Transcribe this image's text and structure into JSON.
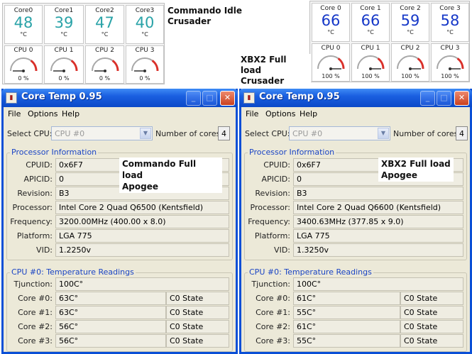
{
  "gadget_left": {
    "cores": [
      {
        "label": "Core0",
        "value": "48",
        "unit": "°C"
      },
      {
        "label": "Core1",
        "value": "39",
        "unit": "°C"
      },
      {
        "label": "Core2",
        "value": "47",
        "unit": "°C"
      },
      {
        "label": "Core3",
        "value": "40",
        "unit": "°C"
      }
    ],
    "meters": [
      {
        "label": "CPU 0",
        "percent_text": "0 %",
        "load": 0
      },
      {
        "label": "CPU 1",
        "percent_text": "0 %",
        "load": 0
      },
      {
        "label": "CPU 2",
        "percent_text": "0 %",
        "load": 0
      },
      {
        "label": "CPU 3",
        "percent_text": "0 %",
        "load": 0
      }
    ],
    "value_color": "#2aa3a8",
    "caption_line1": "Commando Idle",
    "caption_line2": "Crusader"
  },
  "gadget_right": {
    "cores": [
      {
        "label": "Core 0",
        "value": "66",
        "unit": "°C"
      },
      {
        "label": "Core 1",
        "value": "66",
        "unit": "°C"
      },
      {
        "label": "Core 2",
        "value": "59",
        "unit": "°C"
      },
      {
        "label": "Core 3",
        "value": "58",
        "unit": "°C"
      }
    ],
    "meters": [
      {
        "label": "CPU 0",
        "percent_text": "100 %",
        "load": 100
      },
      {
        "label": "CPU 1",
        "percent_text": "100 %",
        "load": 100
      },
      {
        "label": "CPU 2",
        "percent_text": "100 %",
        "load": 100
      },
      {
        "label": "CPU 3",
        "percent_text": "100 %",
        "load": 100
      }
    ],
    "value_color": "#1638c8",
    "caption_line1": "XBX2 Full load",
    "caption_line2": "Crusader"
  },
  "windows": [
    {
      "title": "Core Temp 0.95",
      "menu": [
        "File",
        "Options",
        "Help"
      ],
      "select_cpu_label": "Select CPU:",
      "select_cpu_value": "CPU #0",
      "num_cores_label": "Number of cores",
      "num_cores_value": "4",
      "processor_group_title": "Processor Information",
      "info": [
        {
          "label": "CPUID:",
          "value": "0x6F7"
        },
        {
          "label": "APICID:",
          "value": "0"
        },
        {
          "label": "Revision:",
          "value": "B3"
        },
        {
          "label": "Processor:",
          "value": "Intel Core 2 Quad Q6500 (Kentsfield)"
        },
        {
          "label": "Frequency:",
          "value": "3200.00MHz (400.00 x 8.0)"
        },
        {
          "label": "Platform:",
          "value": "LGA 775"
        },
        {
          "label": "VID:",
          "value": "1.2250v"
        }
      ],
      "overlay_line1": "Commando Full load",
      "overlay_line2": "Apogee",
      "temp_group_title": "CPU #0: Temperature Readings",
      "tjunction_label": "Tjunction:",
      "tjunction_value": "100C°",
      "core_rows": [
        {
          "label": "Core #0:",
          "value": "63C°",
          "state": "C0 State"
        },
        {
          "label": "Core #1:",
          "value": "63C°",
          "state": "C0 State"
        },
        {
          "label": "Core #2:",
          "value": "56C°",
          "state": "C0 State"
        },
        {
          "label": "Core #3:",
          "value": "56C°",
          "state": "C0 State"
        }
      ]
    },
    {
      "title": "Core Temp 0.95",
      "menu": [
        "File",
        "Options",
        "Help"
      ],
      "select_cpu_label": "Select CPU:",
      "select_cpu_value": "CPU #0",
      "num_cores_label": "Number of cores",
      "num_cores_value": "4",
      "processor_group_title": "Processor Information",
      "info": [
        {
          "label": "CPUID:",
          "value": "0x6F7"
        },
        {
          "label": "APICID:",
          "value": "0"
        },
        {
          "label": "Revision:",
          "value": "B3"
        },
        {
          "label": "Processor:",
          "value": "Intel Core 2 Quad Q6600 (Kentsfield)"
        },
        {
          "label": "Frequency:",
          "value": "3400.63MHz (377.85 x 9.0)"
        },
        {
          "label": "Platform:",
          "value": "LGA 775"
        },
        {
          "label": "VID:",
          "value": "1.3250v"
        }
      ],
      "overlay_line1": "XBX2 Full load",
      "overlay_line2": "Apogee",
      "temp_group_title": "CPU #0: Temperature Readings",
      "tjunction_label": "Tjunction:",
      "tjunction_value": "100C°",
      "core_rows": [
        {
          "label": "Core #0:",
          "value": "61C°",
          "state": "C0 State"
        },
        {
          "label": "Core #1:",
          "value": "55C°",
          "state": "C0 State"
        },
        {
          "label": "Core #2:",
          "value": "61C°",
          "state": "C0 State"
        },
        {
          "label": "Core #3:",
          "value": "55C°",
          "state": "C0 State"
        }
      ]
    }
  ],
  "colors": {
    "titlebar": "#0b49c8",
    "window_bg": "#ece9d8",
    "group_title": "#1a44c4",
    "gauge_red": "#d9302a"
  },
  "icons": {
    "minimize": "minimize-icon",
    "maximize": "maximize-icon",
    "close": "close-icon",
    "app": "app-icon",
    "dropdown": "chevron-down-icon"
  }
}
